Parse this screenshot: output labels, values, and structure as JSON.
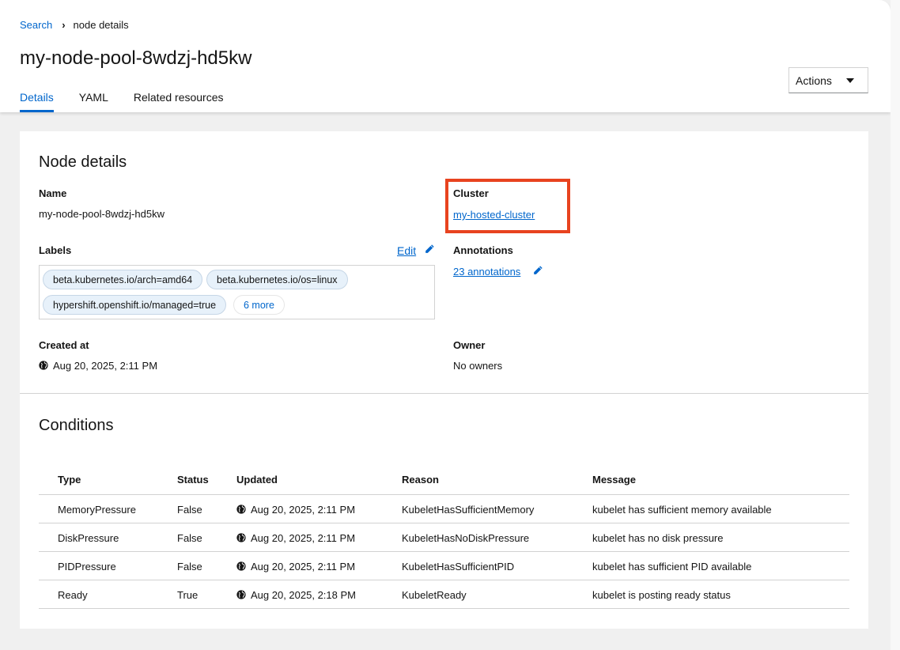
{
  "breadcrumb": {
    "root": "Search",
    "current": "node details"
  },
  "page_title": "my-node-pool-8wdzj-hd5kw",
  "actions_label": "Actions",
  "tabs": [
    {
      "label": "Details",
      "active": true
    },
    {
      "label": "YAML",
      "active": false
    },
    {
      "label": "Related resources",
      "active": false
    }
  ],
  "node_details": {
    "heading": "Node details",
    "name_label": "Name",
    "name_value": "my-node-pool-8wdzj-hd5kw",
    "cluster_label": "Cluster",
    "cluster_value": "my-hosted-cluster",
    "labels_label": "Labels",
    "labels_edit": "Edit",
    "labels": [
      "beta.kubernetes.io/arch=amd64",
      "beta.kubernetes.io/os=linux",
      "hypershift.openshift.io/managed=true"
    ],
    "labels_more": "6 more",
    "annotations_label": "Annotations",
    "annotations_value": "23 annotations",
    "created_label": "Created at",
    "created_value": "Aug 20, 2025, 2:11 PM",
    "owner_label": "Owner",
    "owner_value": "No owners"
  },
  "conditions": {
    "heading": "Conditions",
    "columns": [
      "Type",
      "Status",
      "Updated",
      "Reason",
      "Message"
    ],
    "rows": [
      [
        "MemoryPressure",
        "False",
        "Aug 20, 2025, 2:11 PM",
        "KubeletHasSufficientMemory",
        "kubelet has sufficient memory available"
      ],
      [
        "DiskPressure",
        "False",
        "Aug 20, 2025, 2:11 PM",
        "KubeletHasNoDiskPressure",
        "kubelet has no disk pressure"
      ],
      [
        "PIDPressure",
        "False",
        "Aug 20, 2025, 2:11 PM",
        "KubeletHasSufficientPID",
        "kubelet has sufficient PID available"
      ],
      [
        "Ready",
        "True",
        "Aug 20, 2025, 2:18 PM",
        "KubeletReady",
        "kubelet is posting ready status"
      ]
    ]
  },
  "colors": {
    "link": "#0066cc",
    "highlight": "#e8431f",
    "chip_bg": "#e7f1fa"
  },
  "icons": [
    "chevron-right-icon",
    "caret-down-icon",
    "pencil-icon",
    "globe-icon"
  ]
}
